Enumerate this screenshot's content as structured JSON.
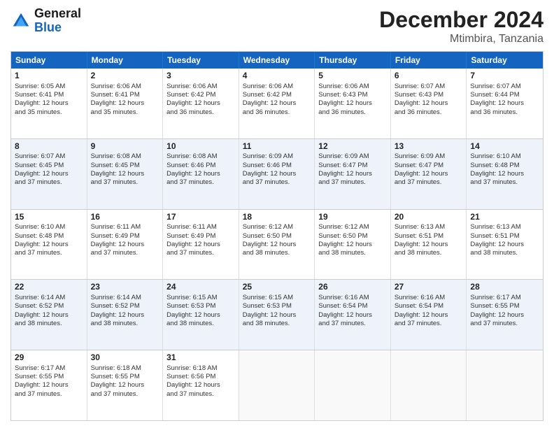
{
  "logo": {
    "general": "General",
    "blue": "Blue"
  },
  "title": "December 2024",
  "subtitle": "Mtimbira, Tanzania",
  "weekdays": [
    "Sunday",
    "Monday",
    "Tuesday",
    "Wednesday",
    "Thursday",
    "Friday",
    "Saturday"
  ],
  "weeks": [
    [
      {
        "day": "1",
        "lines": [
          "Sunrise: 6:05 AM",
          "Sunset: 6:41 PM",
          "Daylight: 12 hours",
          "and 35 minutes."
        ]
      },
      {
        "day": "2",
        "lines": [
          "Sunrise: 6:06 AM",
          "Sunset: 6:41 PM",
          "Daylight: 12 hours",
          "and 35 minutes."
        ]
      },
      {
        "day": "3",
        "lines": [
          "Sunrise: 6:06 AM",
          "Sunset: 6:42 PM",
          "Daylight: 12 hours",
          "and 36 minutes."
        ]
      },
      {
        "day": "4",
        "lines": [
          "Sunrise: 6:06 AM",
          "Sunset: 6:42 PM",
          "Daylight: 12 hours",
          "and 36 minutes."
        ]
      },
      {
        "day": "5",
        "lines": [
          "Sunrise: 6:06 AM",
          "Sunset: 6:43 PM",
          "Daylight: 12 hours",
          "and 36 minutes."
        ]
      },
      {
        "day": "6",
        "lines": [
          "Sunrise: 6:07 AM",
          "Sunset: 6:43 PM",
          "Daylight: 12 hours",
          "and 36 minutes."
        ]
      },
      {
        "day": "7",
        "lines": [
          "Sunrise: 6:07 AM",
          "Sunset: 6:44 PM",
          "Daylight: 12 hours",
          "and 36 minutes."
        ]
      }
    ],
    [
      {
        "day": "8",
        "lines": [
          "Sunrise: 6:07 AM",
          "Sunset: 6:45 PM",
          "Daylight: 12 hours",
          "and 37 minutes."
        ]
      },
      {
        "day": "9",
        "lines": [
          "Sunrise: 6:08 AM",
          "Sunset: 6:45 PM",
          "Daylight: 12 hours",
          "and 37 minutes."
        ]
      },
      {
        "day": "10",
        "lines": [
          "Sunrise: 6:08 AM",
          "Sunset: 6:46 PM",
          "Daylight: 12 hours",
          "and 37 minutes."
        ]
      },
      {
        "day": "11",
        "lines": [
          "Sunrise: 6:09 AM",
          "Sunset: 6:46 PM",
          "Daylight: 12 hours",
          "and 37 minutes."
        ]
      },
      {
        "day": "12",
        "lines": [
          "Sunrise: 6:09 AM",
          "Sunset: 6:47 PM",
          "Daylight: 12 hours",
          "and 37 minutes."
        ]
      },
      {
        "day": "13",
        "lines": [
          "Sunrise: 6:09 AM",
          "Sunset: 6:47 PM",
          "Daylight: 12 hours",
          "and 37 minutes."
        ]
      },
      {
        "day": "14",
        "lines": [
          "Sunrise: 6:10 AM",
          "Sunset: 6:48 PM",
          "Daylight: 12 hours",
          "and 37 minutes."
        ]
      }
    ],
    [
      {
        "day": "15",
        "lines": [
          "Sunrise: 6:10 AM",
          "Sunset: 6:48 PM",
          "Daylight: 12 hours",
          "and 37 minutes."
        ]
      },
      {
        "day": "16",
        "lines": [
          "Sunrise: 6:11 AM",
          "Sunset: 6:49 PM",
          "Daylight: 12 hours",
          "and 37 minutes."
        ]
      },
      {
        "day": "17",
        "lines": [
          "Sunrise: 6:11 AM",
          "Sunset: 6:49 PM",
          "Daylight: 12 hours",
          "and 37 minutes."
        ]
      },
      {
        "day": "18",
        "lines": [
          "Sunrise: 6:12 AM",
          "Sunset: 6:50 PM",
          "Daylight: 12 hours",
          "and 38 minutes."
        ]
      },
      {
        "day": "19",
        "lines": [
          "Sunrise: 6:12 AM",
          "Sunset: 6:50 PM",
          "Daylight: 12 hours",
          "and 38 minutes."
        ]
      },
      {
        "day": "20",
        "lines": [
          "Sunrise: 6:13 AM",
          "Sunset: 6:51 PM",
          "Daylight: 12 hours",
          "and 38 minutes."
        ]
      },
      {
        "day": "21",
        "lines": [
          "Sunrise: 6:13 AM",
          "Sunset: 6:51 PM",
          "Daylight: 12 hours",
          "and 38 minutes."
        ]
      }
    ],
    [
      {
        "day": "22",
        "lines": [
          "Sunrise: 6:14 AM",
          "Sunset: 6:52 PM",
          "Daylight: 12 hours",
          "and 38 minutes."
        ]
      },
      {
        "day": "23",
        "lines": [
          "Sunrise: 6:14 AM",
          "Sunset: 6:52 PM",
          "Daylight: 12 hours",
          "and 38 minutes."
        ]
      },
      {
        "day": "24",
        "lines": [
          "Sunrise: 6:15 AM",
          "Sunset: 6:53 PM",
          "Daylight: 12 hours",
          "and 38 minutes."
        ]
      },
      {
        "day": "25",
        "lines": [
          "Sunrise: 6:15 AM",
          "Sunset: 6:53 PM",
          "Daylight: 12 hours",
          "and 38 minutes."
        ]
      },
      {
        "day": "26",
        "lines": [
          "Sunrise: 6:16 AM",
          "Sunset: 6:54 PM",
          "Daylight: 12 hours",
          "and 37 minutes."
        ]
      },
      {
        "day": "27",
        "lines": [
          "Sunrise: 6:16 AM",
          "Sunset: 6:54 PM",
          "Daylight: 12 hours",
          "and 37 minutes."
        ]
      },
      {
        "day": "28",
        "lines": [
          "Sunrise: 6:17 AM",
          "Sunset: 6:55 PM",
          "Daylight: 12 hours",
          "and 37 minutes."
        ]
      }
    ],
    [
      {
        "day": "29",
        "lines": [
          "Sunrise: 6:17 AM",
          "Sunset: 6:55 PM",
          "Daylight: 12 hours",
          "and 37 minutes."
        ]
      },
      {
        "day": "30",
        "lines": [
          "Sunrise: 6:18 AM",
          "Sunset: 6:55 PM",
          "Daylight: 12 hours",
          "and 37 minutes."
        ]
      },
      {
        "day": "31",
        "lines": [
          "Sunrise: 6:18 AM",
          "Sunset: 6:56 PM",
          "Daylight: 12 hours",
          "and 37 minutes."
        ]
      },
      {
        "day": "",
        "lines": []
      },
      {
        "day": "",
        "lines": []
      },
      {
        "day": "",
        "lines": []
      },
      {
        "day": "",
        "lines": []
      }
    ]
  ]
}
